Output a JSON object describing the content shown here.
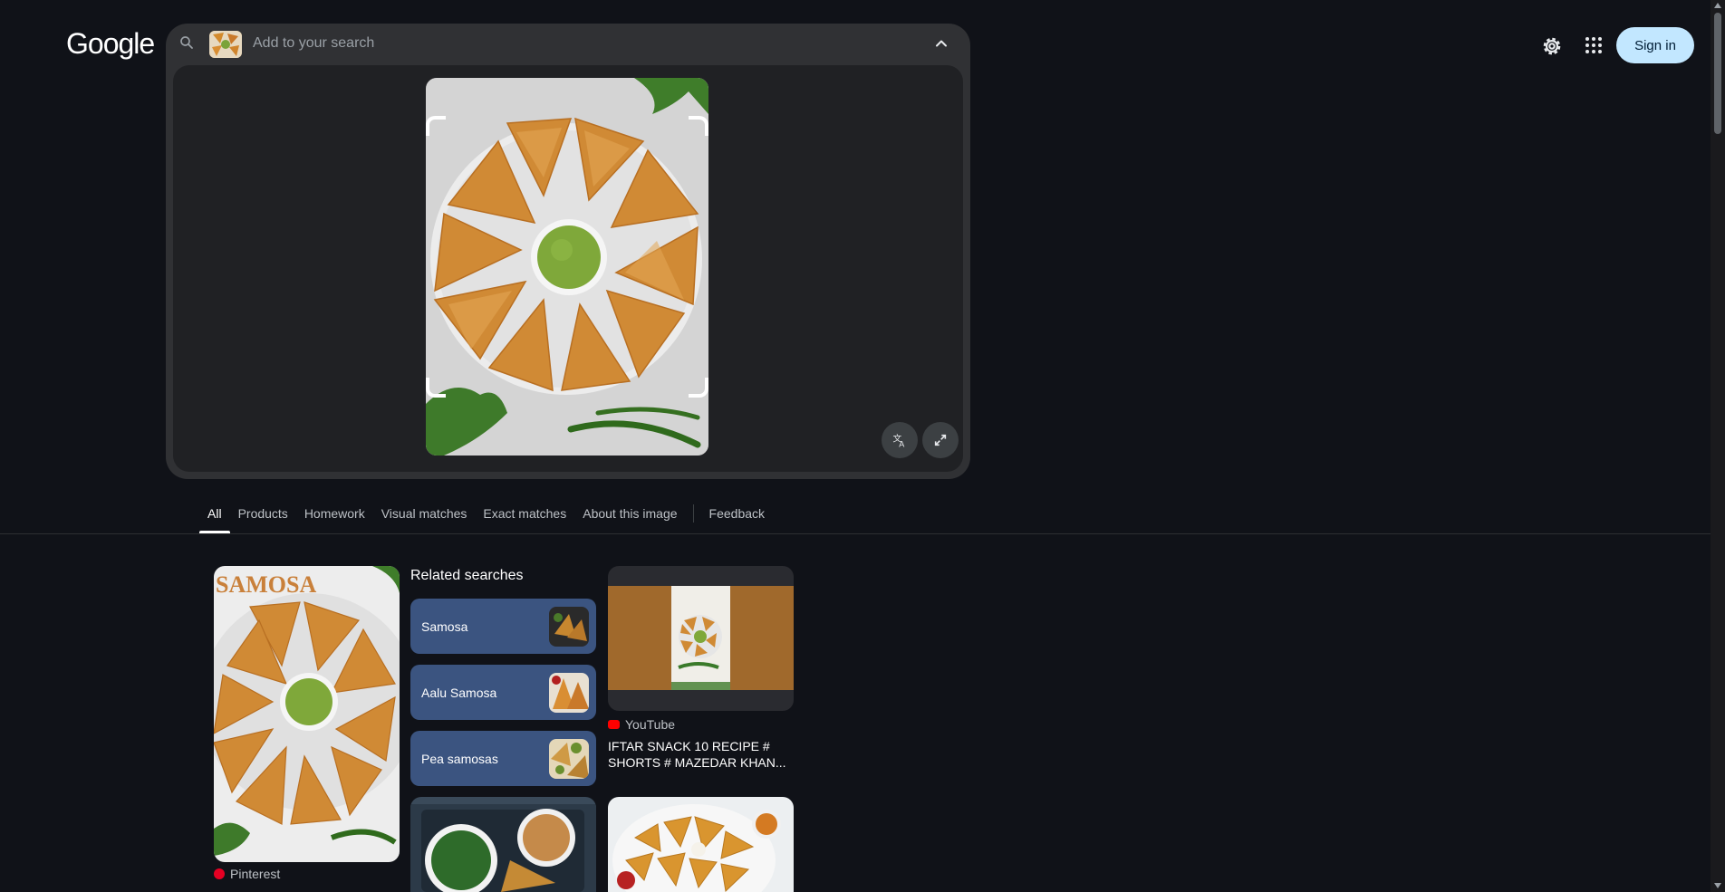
{
  "header": {
    "logo": "Google",
    "sign_in_label": "Sign in"
  },
  "search": {
    "placeholder": "Add to your search",
    "value": ""
  },
  "tabs": [
    {
      "label": "All",
      "active": true
    },
    {
      "label": "Products"
    },
    {
      "label": "Homework"
    },
    {
      "label": "Visual matches"
    },
    {
      "label": "Exact matches"
    },
    {
      "label": "About this image"
    },
    {
      "label": "Feedback"
    }
  ],
  "results": {
    "col1": {
      "overlay_text": "SAMOSA",
      "source": "Pinterest"
    },
    "related": {
      "title": "Related searches",
      "items": [
        {
          "label": "Samosa"
        },
        {
          "label": "Aalu Samosa"
        },
        {
          "label": "Pea samosas"
        }
      ]
    },
    "col3": {
      "source": "YouTube",
      "title": "IFTAR SNACK 10 RECIPE # SHORTS # MAZEDAR KHAN..."
    }
  },
  "colors": {
    "background": "#101218",
    "search_shell": "#303134",
    "related_item": "#3b5480",
    "sign_in_bg": "#c2e7ff",
    "youtube_red": "#ff0000",
    "pinterest_red": "#e60023"
  },
  "icons": [
    "search-icon",
    "chevron-up-icon",
    "translate-icon",
    "expand-icon",
    "gear-icon",
    "apps-grid-icon",
    "pinterest-icon",
    "youtube-icon"
  ]
}
